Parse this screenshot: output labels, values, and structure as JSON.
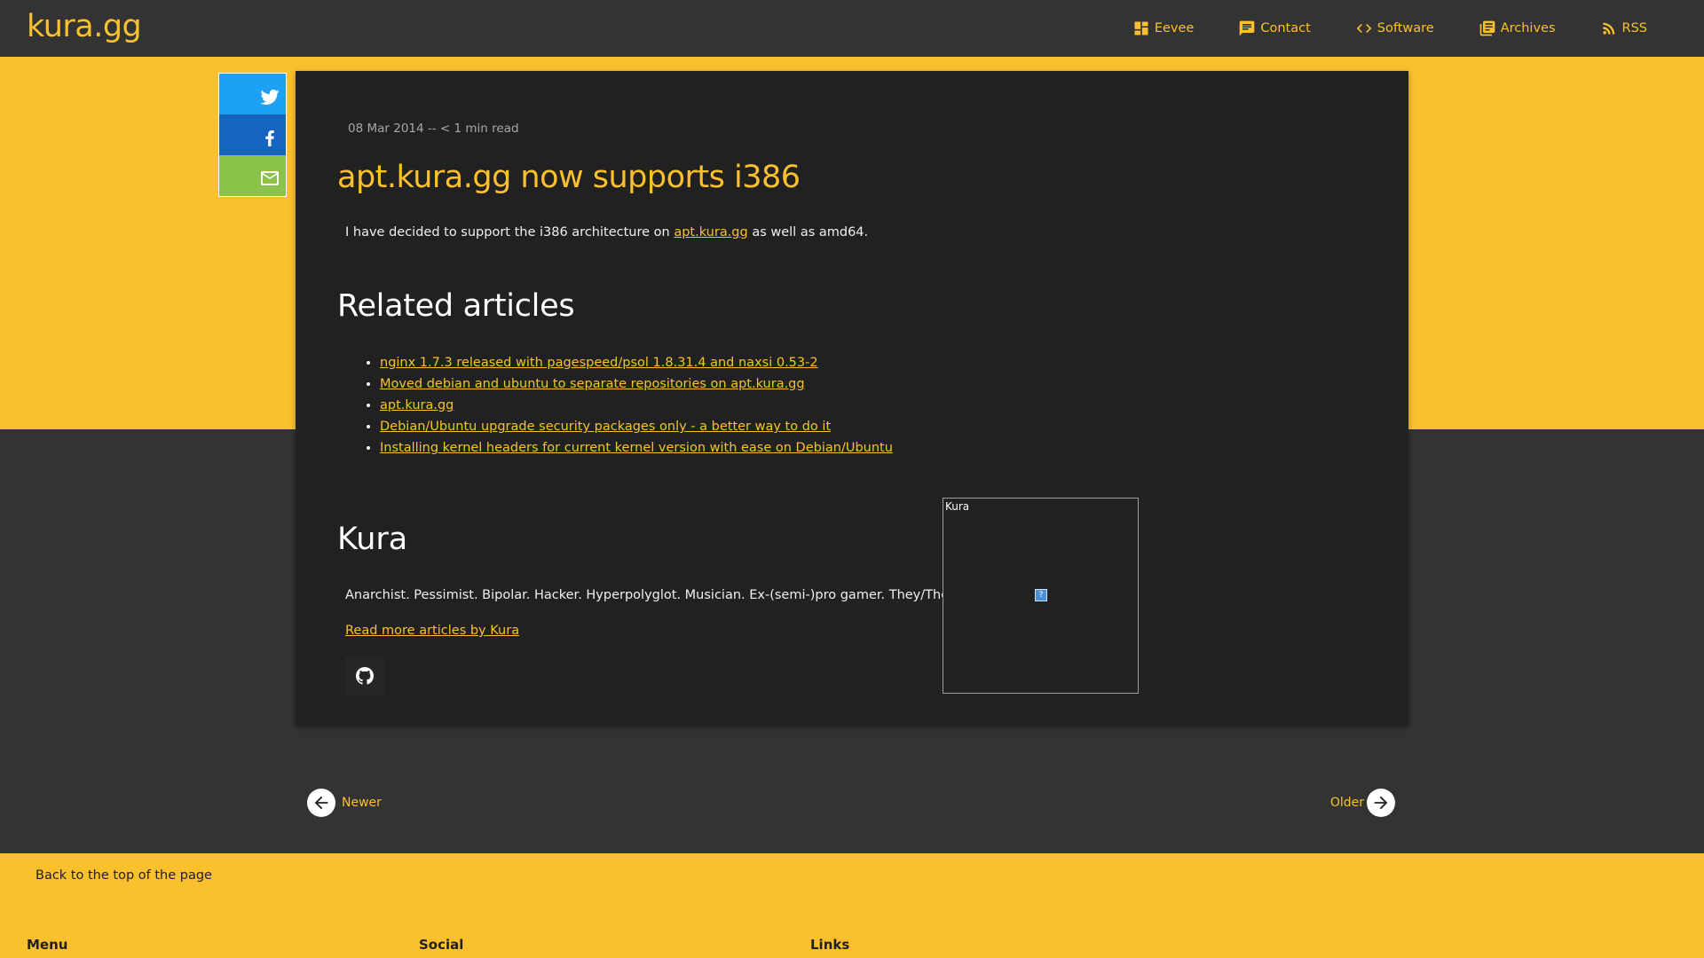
{
  "site": {
    "logo": "kura.gg"
  },
  "nav": [
    {
      "label": "Eevee",
      "icon": "dashboard-icon"
    },
    {
      "label": "Contact",
      "icon": "chat-icon"
    },
    {
      "label": "Software",
      "icon": "code-icon"
    },
    {
      "label": "Archives",
      "icon": "library-icon"
    },
    {
      "label": "RSS",
      "icon": "rss-icon"
    }
  ],
  "share": [
    {
      "network": "twitter",
      "icon": "twitter-icon",
      "color": "#1da1f2"
    },
    {
      "network": "facebook",
      "icon": "facebook-icon",
      "color": "#1565c0"
    },
    {
      "network": "email",
      "icon": "mail-icon",
      "color": "#8bc34a"
    }
  ],
  "post": {
    "meta": "08 Mar 2014 -- < 1 min read",
    "title": "apt.kura.gg now supports i386",
    "body_before": "I have decided to support the i386 architecture on ",
    "body_link": "apt.kura.gg",
    "body_after": " as well as amd64."
  },
  "related": {
    "heading": "Related articles",
    "items": [
      "nginx 1.7.3 released with pagespeed/psol 1.8.31.4 and naxsi 0.53-2",
      "Moved debian and ubuntu to separate repositories on apt.kura.gg",
      "apt.kura.gg",
      "Debian/Ubuntu upgrade security packages only - a better way to do it",
      "Installing kernel headers for current kernel version with ease on Debian/Ubuntu"
    ]
  },
  "author": {
    "name": "Kura",
    "bio": "Anarchist. Pessimist. Bipolar. Hacker. Hyperpolyglot. Musician. Ex-(semi-)pro gamer. They/Them.",
    "more": "Read more articles by Kura",
    "avatar_alt": "Kura",
    "social_icon": "github-icon"
  },
  "pagination": {
    "newer": "Newer",
    "older": "Older"
  },
  "footer": {
    "back_to_top": "Back to the top of the page",
    "menu": "Menu",
    "social": "Social",
    "links": "Links"
  },
  "colors": {
    "accent": "#fbc02d",
    "card": "#212121",
    "page": "#333333"
  }
}
